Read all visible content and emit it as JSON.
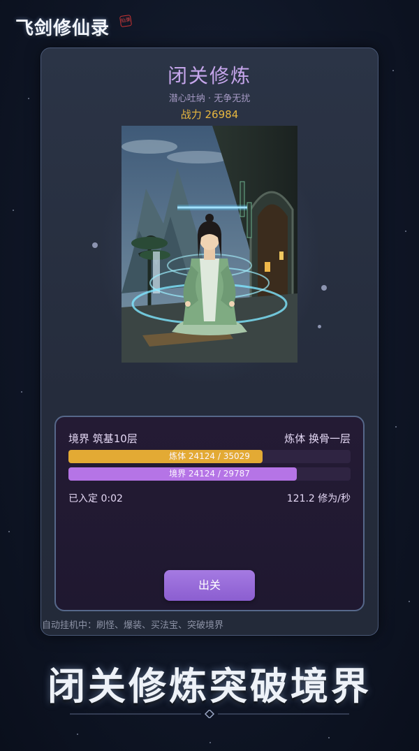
{
  "logo": {
    "text": "飞剑修仙录",
    "seal_text": "仙录"
  },
  "page": {
    "title": "闭关修炼",
    "subtitle": "潜心吐纳 · 无争无扰",
    "power": "战力 26984"
  },
  "stats": {
    "realm": "境界 筑基10层",
    "body_realm": "炼体 换骨一层",
    "body_bar": {
      "label": "炼体 24124 / 35029",
      "current": 24124,
      "max": 35029,
      "color": "#e3aa34"
    },
    "realm_bar": {
      "label": "境界 24124 / 29787",
      "current": 24124,
      "max": 29787,
      "color": "#b574e6"
    },
    "meditating": "已入定 0:02",
    "rate": "121.2 修为/秒"
  },
  "exit_button": "出关",
  "auto_note": "自动挂机中：刷怪、爆装、买法宝、突破境界",
  "banner": "闭关修炼突破境界",
  "icons": [
    "meditation-cultivator-art",
    "divider-diamond-icon",
    "logo-seal-icon"
  ]
}
